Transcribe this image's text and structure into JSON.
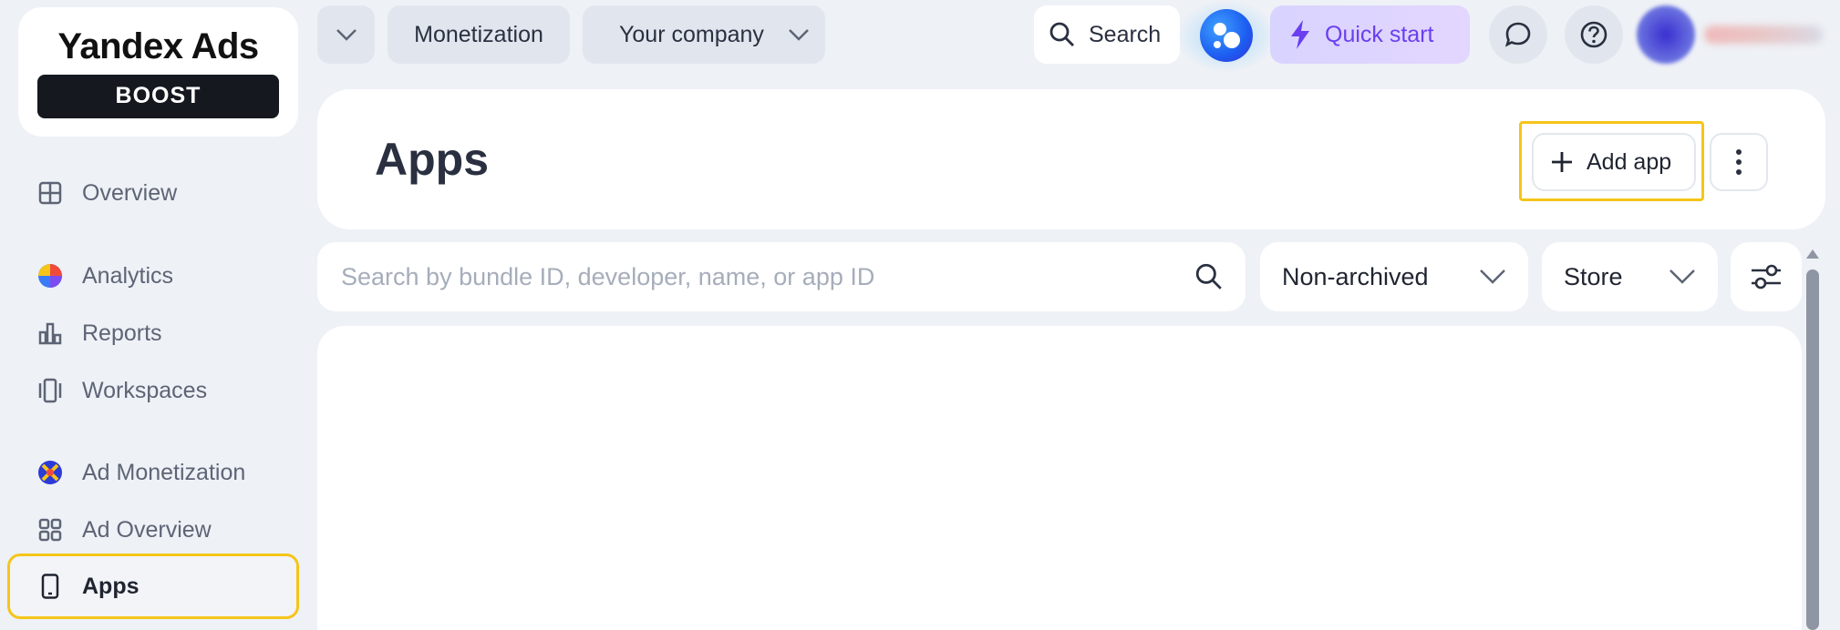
{
  "brand": {
    "title": "Yandex Ads",
    "badge": "BOOST"
  },
  "sidebar": {
    "items": [
      {
        "label": "Overview",
        "icon": "grid-icon"
      },
      {
        "label": "Analytics",
        "icon": "analytics-icon"
      },
      {
        "label": "Reports",
        "icon": "bar-chart-icon"
      },
      {
        "label": "Workspaces",
        "icon": "workspaces-icon"
      },
      {
        "label": "Ad Monetization",
        "icon": "ad-monetization-icon"
      },
      {
        "label": "Ad Overview",
        "icon": "four-squares-icon"
      },
      {
        "label": "Apps",
        "icon": "phone-icon",
        "active": true
      }
    ]
  },
  "topbar": {
    "monetization_label": "Monetization",
    "company_label": "Your company",
    "search_label": "Search",
    "quick_start_label": "Quick start"
  },
  "page": {
    "title": "Apps",
    "add_app_label": "Add app"
  },
  "filters": {
    "search_placeholder": "Search by bundle ID, developer, name, or app ID",
    "status_value": "Non-archived",
    "store_value": "Store"
  },
  "colors": {
    "highlight": "#f5c518",
    "accent_purple": "#6a3ff0",
    "background": "#eef1f6"
  }
}
